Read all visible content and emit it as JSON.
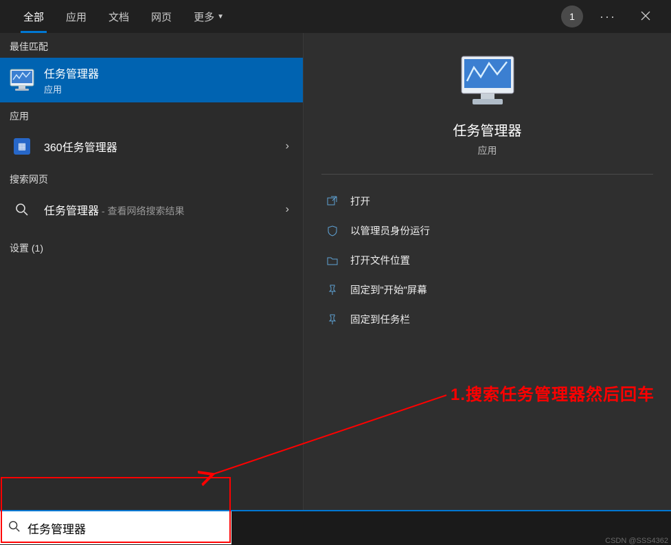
{
  "topbar": {
    "tabs": [
      "全部",
      "应用",
      "文档",
      "网页",
      "更多"
    ],
    "badge": "1"
  },
  "left": {
    "best_match_label": "最佳匹配",
    "best_match": {
      "title": "任务管理器",
      "sub": "应用"
    },
    "apps_label": "应用",
    "app_item": {
      "title": "360任务管理器"
    },
    "web_label": "搜索网页",
    "web_item": {
      "title": "任务管理器",
      "suffix": " - 查看网络搜索结果"
    },
    "settings_label": "设置 (1)"
  },
  "detail": {
    "title": "任务管理器",
    "sub": "应用",
    "actions": [
      "打开",
      "以管理员身份运行",
      "打开文件位置",
      "固定到\"开始\"屏幕",
      "固定到任务栏"
    ]
  },
  "annotation": "1.搜索任务管理器然后回车",
  "search": {
    "value": "任务管理器"
  },
  "watermark": "CSDN @SSS4362"
}
